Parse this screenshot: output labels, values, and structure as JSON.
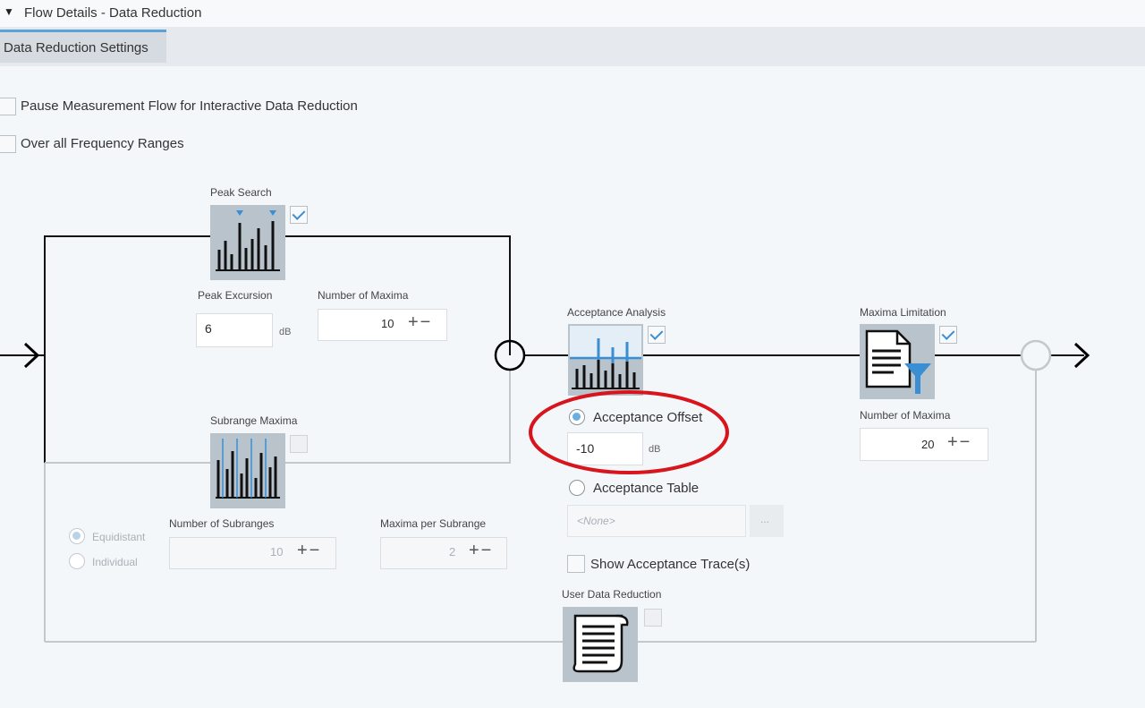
{
  "header": {
    "collapse_icon": "triangle-down-icon",
    "title": "Flow Details  -  Data Reduction"
  },
  "tabs": [
    {
      "label": "Data Reduction Settings",
      "active": true
    }
  ],
  "options": {
    "pause_flow": {
      "label": "Pause Measurement Flow for Interactive Data Reduction",
      "checked": false
    },
    "over_all_ranges": {
      "label": "Over all Frequency Ranges",
      "checked": false
    }
  },
  "peak_search": {
    "title": "Peak Search",
    "enabled": true,
    "icon": "peak-search-icon",
    "excursion_label": "Peak Excursion",
    "excursion_value": "6",
    "excursion_unit": "dB",
    "maxima_label": "Number of Maxima",
    "maxima_value": "10"
  },
  "subrange_maxima": {
    "title": "Subrange Maxima",
    "enabled": false,
    "icon": "subrange-maxima-icon",
    "mode_equidistant": "Equidistant",
    "mode_individual": "Individual",
    "subranges_label": "Number of Subranges",
    "subranges_value": "10",
    "per_subrange_label": "Maxima per Subrange",
    "per_subrange_value": "2"
  },
  "acceptance_analysis": {
    "title": "Acceptance Analysis",
    "enabled": true,
    "icon": "acceptance-analysis-icon",
    "offset_label": "Acceptance Offset",
    "offset_value": "-10",
    "offset_unit": "dB",
    "table_label": "Acceptance Table",
    "table_value": "<None>",
    "browse_label": "...",
    "show_trace_label": "Show Acceptance Trace(s)"
  },
  "maxima_limitation": {
    "title": "Maxima Limitation",
    "enabled": true,
    "icon": "document-filter-icon",
    "maxima_label": "Number of Maxima",
    "maxima_value": "20"
  },
  "user_data_reduction": {
    "title": "User Data Reduction",
    "enabled": false,
    "icon": "script-document-icon"
  },
  "stepper_symbols": "+−",
  "colors": {
    "accent": "#3a8fd4",
    "highlight_ellipse": "#d8141c",
    "icon_bg": "#b8c3cc"
  }
}
